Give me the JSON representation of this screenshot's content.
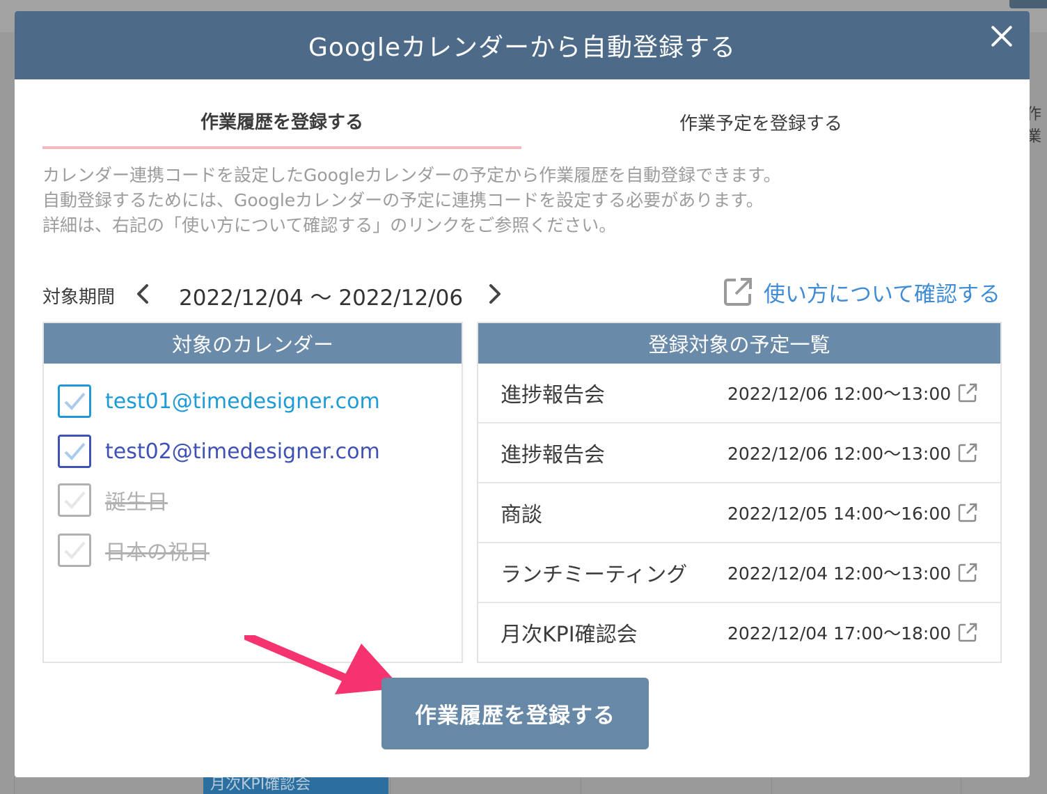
{
  "background": {
    "side_text": "作業",
    "event_label": "月次KPI確認会"
  },
  "modal": {
    "title": "Googleカレンダーから自動登録する",
    "header_color": "#4d6b88"
  },
  "tabs": [
    {
      "label": "作業履歴を登録する",
      "active": true
    },
    {
      "label": "作業予定を登録する",
      "active": false
    }
  ],
  "description": [
    "カレンダー連携コードを設定したGoogleカレンダーの予定から作業履歴を自動登録できます。",
    "自動登録するためには、Googleカレンダーの予定に連携コードを設定する必要があります。",
    "詳細は、右記の「使い方について確認する」のリンクをご参照ください。"
  ],
  "period": {
    "label": "対象期間",
    "value": "2022/12/04 〜 2022/12/06"
  },
  "help_link": {
    "label": "使い方について確認する",
    "color": "#3f8cd4"
  },
  "calendars": {
    "header": "対象のカレンダー",
    "items": [
      {
        "label": "test01@timedesigner.com",
        "checked": true,
        "enabled": true,
        "color": "#1e9bd7"
      },
      {
        "label": "test02@timedesigner.com",
        "checked": true,
        "enabled": true,
        "color": "#3f51b5"
      },
      {
        "label": "誕生日",
        "checked": false,
        "enabled": false,
        "color": "#b0b0b0"
      },
      {
        "label": "日本の祝日",
        "checked": false,
        "enabled": false,
        "color": "#b0b0b0"
      }
    ]
  },
  "events": {
    "header": "登録対象の予定一覧",
    "items": [
      {
        "name": "進捗報告会",
        "time": "2022/12/06 12:00〜13:00"
      },
      {
        "name": "進捗報告会",
        "time": "2022/12/06 12:00〜13:00"
      },
      {
        "name": "商談",
        "time": "2022/12/05 14:00〜16:00"
      },
      {
        "name": "ランチミーティング",
        "time": "2022/12/04 12:00〜13:00"
      },
      {
        "name": "月次KPI確認会",
        "time": "2022/12/04 17:00〜18:00"
      }
    ]
  },
  "submit_button": {
    "label": "作業履歴を登録する"
  },
  "colors": {
    "accent_arrow": "#f5336f",
    "tab_underline": "#f7b9bd",
    "panel_header": "#6a8aa9",
    "button": "#6788a6"
  }
}
